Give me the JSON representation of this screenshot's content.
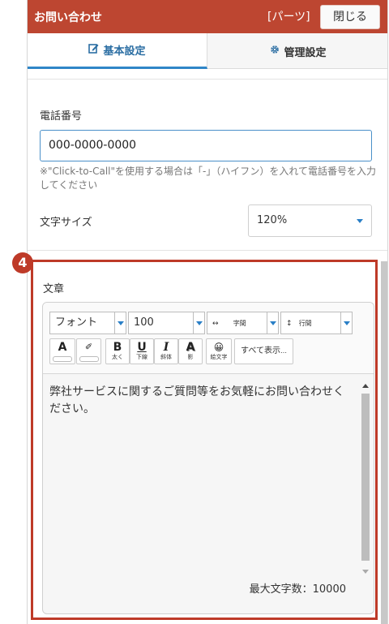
{
  "header": {
    "title": "お問い合わせ",
    "parts": "[パーツ]",
    "close_label": "閉じる"
  },
  "tabs": [
    {
      "label": "基本設定",
      "icon": "edit-icon"
    },
    {
      "label": "管理設定",
      "icon": "gear-icon"
    }
  ],
  "phone": {
    "label": "電話番号",
    "value": "000-0000-0000",
    "note": "※\"Click-to-Call\"を使用する場合は「-」（ハイフン）を入れて電話番号を入力してください"
  },
  "font_size": {
    "label": "文字サイズ",
    "value": "120%"
  },
  "badge": "4",
  "text_section": {
    "label": "文章"
  },
  "editor": {
    "font_select": "フォント",
    "size_select": "100",
    "letter_spacing_label": "字間",
    "line_spacing_label": "行間",
    "buttons": {
      "text_color": "A",
      "highlight": "✐",
      "bold": "B",
      "bold_sub": "太く",
      "underline": "U",
      "underline_sub": "下線",
      "italic": "I",
      "italic_sub": "斜体",
      "shadow": "A",
      "shadow_sub": "影",
      "emoji": "😀",
      "emoji_sub": "絵文字",
      "show_all": "すべて表示"
    },
    "content": "弊社サービスに関するご質問等をお気軽にお問い合わせください。",
    "counter": "最大文字数：10000"
  },
  "colors": {
    "header_bg": "#bd4631",
    "accent": "#2f86c8",
    "highlight_frame": "#be3a28"
  }
}
